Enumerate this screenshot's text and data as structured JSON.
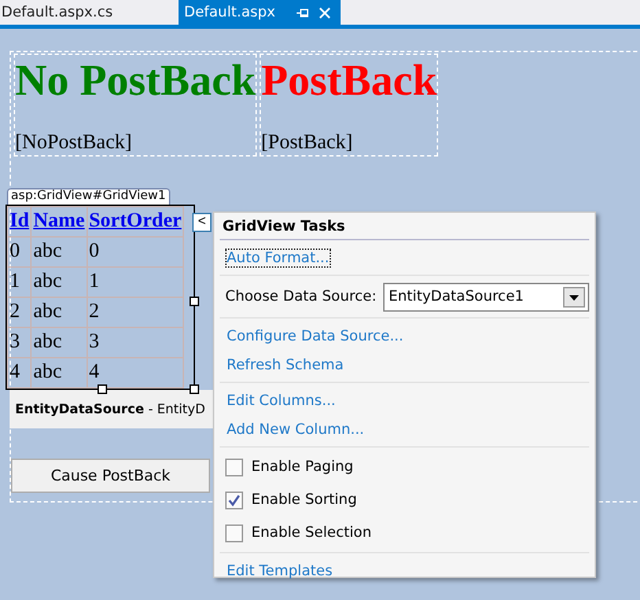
{
  "tabs": [
    {
      "label": "Default.aspx.cs",
      "selected": false
    },
    {
      "label": "Default.aspx",
      "selected": true
    }
  ],
  "header_cells": [
    {
      "heading": "No PostBack",
      "color": "#008000",
      "label": "[NoPostBack]"
    },
    {
      "heading": "PostBack",
      "color": "#ff0000",
      "label": "[PostBack]"
    }
  ],
  "gridview": {
    "tag": "asp:GridView#GridView1",
    "columns": [
      "Id",
      "Name",
      "SortOrder"
    ],
    "rows": [
      [
        "0",
        "abc",
        "0"
      ],
      [
        "1",
        "abc",
        "1"
      ],
      [
        "2",
        "abc",
        "2"
      ],
      [
        "3",
        "abc",
        "3"
      ],
      [
        "4",
        "abc",
        "4"
      ]
    ],
    "smart_tag": "<"
  },
  "data_source": "**EntityDataSource** - EntityD",
  "button": "Cause PostBack",
  "tasks": {
    "title": "GridView Tasks",
    "items": [
      {
        "kind": "link",
        "label": "Auto Format...",
        "focused": true
      },
      {
        "kind": "select",
        "label": "Choose Data Source:",
        "value": "EntityDataSource1"
      },
      {
        "kind": "link",
        "label": "Configure Data Source...",
        "focused": false
      },
      {
        "kind": "link",
        "label": "Refresh Schema",
        "focused": false
      },
      {
        "kind": "link",
        "label": "Edit Columns...",
        "focused": false
      },
      {
        "kind": "link",
        "label": "Add New Column...",
        "focused": false
      },
      {
        "kind": "check",
        "label": "Enable Paging",
        "checked": false
      },
      {
        "kind": "check",
        "label": "Enable Sorting",
        "checked": true
      },
      {
        "kind": "check",
        "label": "Enable Selection",
        "checked": false
      },
      {
        "kind": "link",
        "label": "Edit Templates",
        "focused": false
      }
    ]
  }
}
